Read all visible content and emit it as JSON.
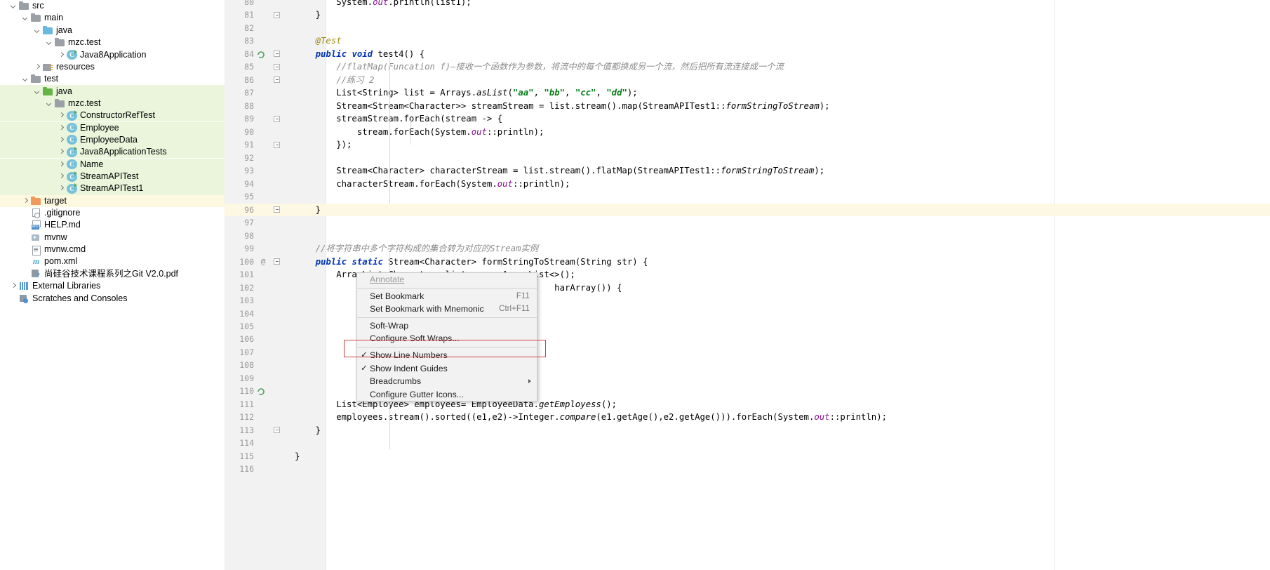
{
  "project_tree": {
    "name": "project-tool-window",
    "items": [
      {
        "label": "src",
        "indent": 0,
        "arrow": "down",
        "icon": "folder-grey",
        "row_state": "none"
      },
      {
        "label": "main",
        "indent": 1,
        "arrow": "down",
        "icon": "folder-grey",
        "row_state": "none"
      },
      {
        "label": "java",
        "indent": 2,
        "arrow": "down",
        "icon": "folder-blue",
        "row_state": "none"
      },
      {
        "label": "mzc.test",
        "indent": 3,
        "arrow": "down",
        "icon": "folder-grey",
        "row_state": "none"
      },
      {
        "label": "Java8Application",
        "indent": 4,
        "arrow": "right",
        "icon": "class-runnable",
        "row_state": "none"
      },
      {
        "label": "resources",
        "indent": 2,
        "arrow": "right",
        "icon": "folder-res",
        "row_state": "none"
      },
      {
        "label": "test",
        "indent": 1,
        "arrow": "down",
        "icon": "folder-grey",
        "row_state": "none"
      },
      {
        "label": "java",
        "indent": 2,
        "arrow": "down",
        "icon": "folder-green",
        "row_state": "green"
      },
      {
        "label": "mzc.test",
        "indent": 3,
        "arrow": "down",
        "icon": "folder-grey",
        "row_state": "green"
      },
      {
        "label": "ConstructorRefTest",
        "indent": 4,
        "arrow": "right",
        "icon": "class-runnable",
        "row_state": "green"
      },
      {
        "label": "Employee",
        "indent": 4,
        "arrow": "right",
        "icon": "class",
        "row_state": "green"
      },
      {
        "label": "EmployeeData",
        "indent": 4,
        "arrow": "right",
        "icon": "class",
        "row_state": "green"
      },
      {
        "label": "Java8ApplicationTests",
        "indent": 4,
        "arrow": "right",
        "icon": "class-runnable",
        "row_state": "green"
      },
      {
        "label": "Name",
        "indent": 4,
        "arrow": "right",
        "icon": "class",
        "row_state": "green"
      },
      {
        "label": "StreamAPITest",
        "indent": 4,
        "arrow": "right",
        "icon": "class-runnable",
        "row_state": "green"
      },
      {
        "label": "StreamAPITest1",
        "indent": 4,
        "arrow": "right",
        "icon": "class-runnable",
        "row_state": "green"
      },
      {
        "label": "target",
        "indent": 1,
        "arrow": "right",
        "icon": "folder-orange",
        "row_state": "yellow"
      },
      {
        "label": ".gitignore",
        "indent": 1,
        "arrow": "none",
        "icon": "file-gitignore",
        "row_state": "none"
      },
      {
        "label": "HELP.md",
        "indent": 1,
        "arrow": "none",
        "icon": "file-md",
        "row_state": "none"
      },
      {
        "label": "mvnw",
        "indent": 1,
        "arrow": "none",
        "icon": "file-script",
        "row_state": "none"
      },
      {
        "label": "mvnw.cmd",
        "indent": 1,
        "arrow": "none",
        "icon": "file-generic",
        "row_state": "none"
      },
      {
        "label": "pom.xml",
        "indent": 1,
        "arrow": "none",
        "icon": "file-maven",
        "row_state": "none"
      },
      {
        "label": "尚硅谷技术课程系列之Git V2.0.pdf",
        "indent": 1,
        "arrow": "none",
        "icon": "file-pdf",
        "row_state": "none"
      },
      {
        "label": "External Libraries",
        "indent": 0,
        "arrow": "right",
        "icon": "ext-lib",
        "row_state": "none"
      },
      {
        "label": "Scratches and Consoles",
        "indent": 0,
        "arrow": "none",
        "icon": "scratches",
        "row_state": "none"
      }
    ]
  },
  "editor": {
    "name": "code-editor",
    "highlighted_line": 96,
    "lines": [
      {
        "num": 80,
        "html": "        System.<i class='field'>out</i>.println(list1);",
        "fold": false,
        "mark": "",
        "run": false
      },
      {
        "num": 81,
        "html": "    }",
        "fold": true,
        "mark": "",
        "run": false
      },
      {
        "num": 82,
        "html": "",
        "fold": false,
        "mark": "",
        "run": false
      },
      {
        "num": 83,
        "html": "    <i class='anno'>@Test</i>",
        "fold": false,
        "mark": "",
        "run": false
      },
      {
        "num": 84,
        "html": "    <i class='kw'>public</i> <i class='kw'>void</i> test4() {",
        "fold": true,
        "mark": "",
        "run": true
      },
      {
        "num": 85,
        "html": "        <i class='cmt'>//flatMap(Funcation f)—接收一个函数作为参数，将流中的每个值都换成另一个流，然后把所有流连接成一个流</i>",
        "fold": true,
        "mark": "",
        "run": false
      },
      {
        "num": 86,
        "html": "        <i class='cmt'>//练习 2</i>",
        "fold": true,
        "mark": "",
        "run": false
      },
      {
        "num": 87,
        "html": "        List&lt;String&gt; list = Arrays.<i class='mth-static'>asList</i>(<i class='str'>\"aa\"</i>, <i class='str'>\"bb\"</i>, <i class='str'>\"cc\"</i>, <i class='str'>\"dd\"</i>);",
        "fold": false,
        "mark": "",
        "run": false
      },
      {
        "num": 88,
        "html": "        Stream&lt;Stream&lt;Character&gt;&gt; streamStream = list.stream().map(StreamAPITest1::<i class='mth-static'>formStringToStream</i>);",
        "fold": false,
        "mark": "",
        "run": false
      },
      {
        "num": 89,
        "html": "        streamStream.forEach(stream -&gt; {",
        "fold": true,
        "mark": "",
        "run": false
      },
      {
        "num": 90,
        "html": "            stream.forEach(System.<i class='field'>out</i>::println);",
        "fold": false,
        "mark": "",
        "run": false
      },
      {
        "num": 91,
        "html": "        });",
        "fold": true,
        "mark": "",
        "run": false
      },
      {
        "num": 92,
        "html": "",
        "fold": false,
        "mark": "",
        "run": false
      },
      {
        "num": 93,
        "html": "        Stream&lt;Character&gt; characterStream = list.stream().flatMap(StreamAPITest1::<i class='mth-static'>formStringToStream</i>);",
        "fold": false,
        "mark": "",
        "run": false
      },
      {
        "num": 94,
        "html": "        characterStream.forEach(System.<i class='field'>out</i>::println);",
        "fold": false,
        "mark": "",
        "run": false
      },
      {
        "num": 95,
        "html": "",
        "fold": false,
        "mark": "",
        "run": false
      },
      {
        "num": 96,
        "html": "    }",
        "fold": true,
        "mark": "",
        "run": false
      },
      {
        "num": 97,
        "html": "",
        "fold": false,
        "mark": "",
        "run": false
      },
      {
        "num": 98,
        "html": "",
        "fold": false,
        "mark": "",
        "run": false
      },
      {
        "num": 99,
        "html": "    <i class='cmt'>//将字符串中多个字符构成的集合转为对应的Stream实例</i>",
        "fold": false,
        "mark": "",
        "run": false
      },
      {
        "num": 100,
        "html": "    <i class='kw'>public</i> <i class='kw'>static</i> Stream&lt;Character&gt; formStringToStream(String str) {",
        "fold": true,
        "mark": "@",
        "run": false
      },
      {
        "num": 101,
        "html": "        ArrayList&lt;Character&gt; list = <i class='kw'>new</i> ArrayList&lt;&gt;();",
        "fold": false,
        "mark": "",
        "run": false
      },
      {
        "num": 102,
        "html": "                                                  harArray()) {",
        "fold": false,
        "mark": "",
        "run": false
      },
      {
        "num": 103,
        "html": "",
        "fold": false,
        "mark": "",
        "run": false
      },
      {
        "num": 104,
        "html": "",
        "fold": false,
        "mark": "",
        "run": false
      },
      {
        "num": 105,
        "html": "",
        "fold": false,
        "mark": "",
        "run": false
      },
      {
        "num": 106,
        "html": "",
        "fold": false,
        "mark": "",
        "run": false
      },
      {
        "num": 107,
        "html": "",
        "fold": false,
        "mark": "",
        "run": false
      },
      {
        "num": 108,
        "html": "",
        "fold": false,
        "mark": "",
        "run": false
      },
      {
        "num": 109,
        "html": "",
        "fold": false,
        "mark": "",
        "run": false
      },
      {
        "num": 110,
        "html": "",
        "fold": false,
        "mark": "",
        "run": true
      },
      {
        "num": 111,
        "html": "        List&lt;Employee&gt; employees= EmployeeData.<i class='mth-static'>getEmployess</i>();",
        "fold": false,
        "mark": "",
        "run": false
      },
      {
        "num": 112,
        "html": "        employees.stream().sorted((e1,e2)-&gt;Integer.<i class='mth-static'>compare</i>(e1.getAge(),e2.getAge())).forEach(System.<i class='field'>out</i>::println);",
        "fold": false,
        "mark": "",
        "run": false
      },
      {
        "num": 113,
        "html": "    }",
        "fold": true,
        "mark": "",
        "run": false
      },
      {
        "num": 114,
        "html": "",
        "fold": false,
        "mark": "",
        "run": false
      },
      {
        "num": 115,
        "html": "}",
        "fold": false,
        "mark": "",
        "run": false
      },
      {
        "num": 116,
        "html": "",
        "fold": false,
        "mark": "",
        "run": false
      }
    ]
  },
  "context_menu": {
    "name": "gutter-context-menu",
    "items": [
      {
        "type": "item",
        "label": "Annotate",
        "shortcut": "",
        "checked": false,
        "disabled": true,
        "submenu": false
      },
      {
        "type": "separator"
      },
      {
        "type": "item",
        "label": "Set Bookmark",
        "shortcut": "F11",
        "checked": false,
        "disabled": false,
        "submenu": false
      },
      {
        "type": "item",
        "label": "Set Bookmark with Mnemonic",
        "shortcut": "Ctrl+F11",
        "checked": false,
        "disabled": false,
        "submenu": false
      },
      {
        "type": "separator"
      },
      {
        "type": "item",
        "label": "Soft-Wrap",
        "shortcut": "",
        "checked": false,
        "disabled": false,
        "submenu": false
      },
      {
        "type": "item",
        "label": "Configure Soft Wraps...",
        "shortcut": "",
        "checked": false,
        "disabled": false,
        "submenu": false
      },
      {
        "type": "separator"
      },
      {
        "type": "item",
        "label": "Show Line Numbers",
        "shortcut": "",
        "checked": true,
        "disabled": false,
        "submenu": false,
        "highlight": true
      },
      {
        "type": "item",
        "label": "Show Indent Guides",
        "shortcut": "",
        "checked": true,
        "disabled": false,
        "submenu": false
      },
      {
        "type": "item",
        "label": "Breadcrumbs",
        "shortcut": "",
        "checked": false,
        "disabled": false,
        "submenu": true
      },
      {
        "type": "item",
        "label": "Configure Gutter Icons...",
        "shortcut": "",
        "checked": false,
        "disabled": false,
        "submenu": false
      }
    ],
    "checkmark_glyph": "✓",
    "highlight_color": "#cf4040"
  }
}
